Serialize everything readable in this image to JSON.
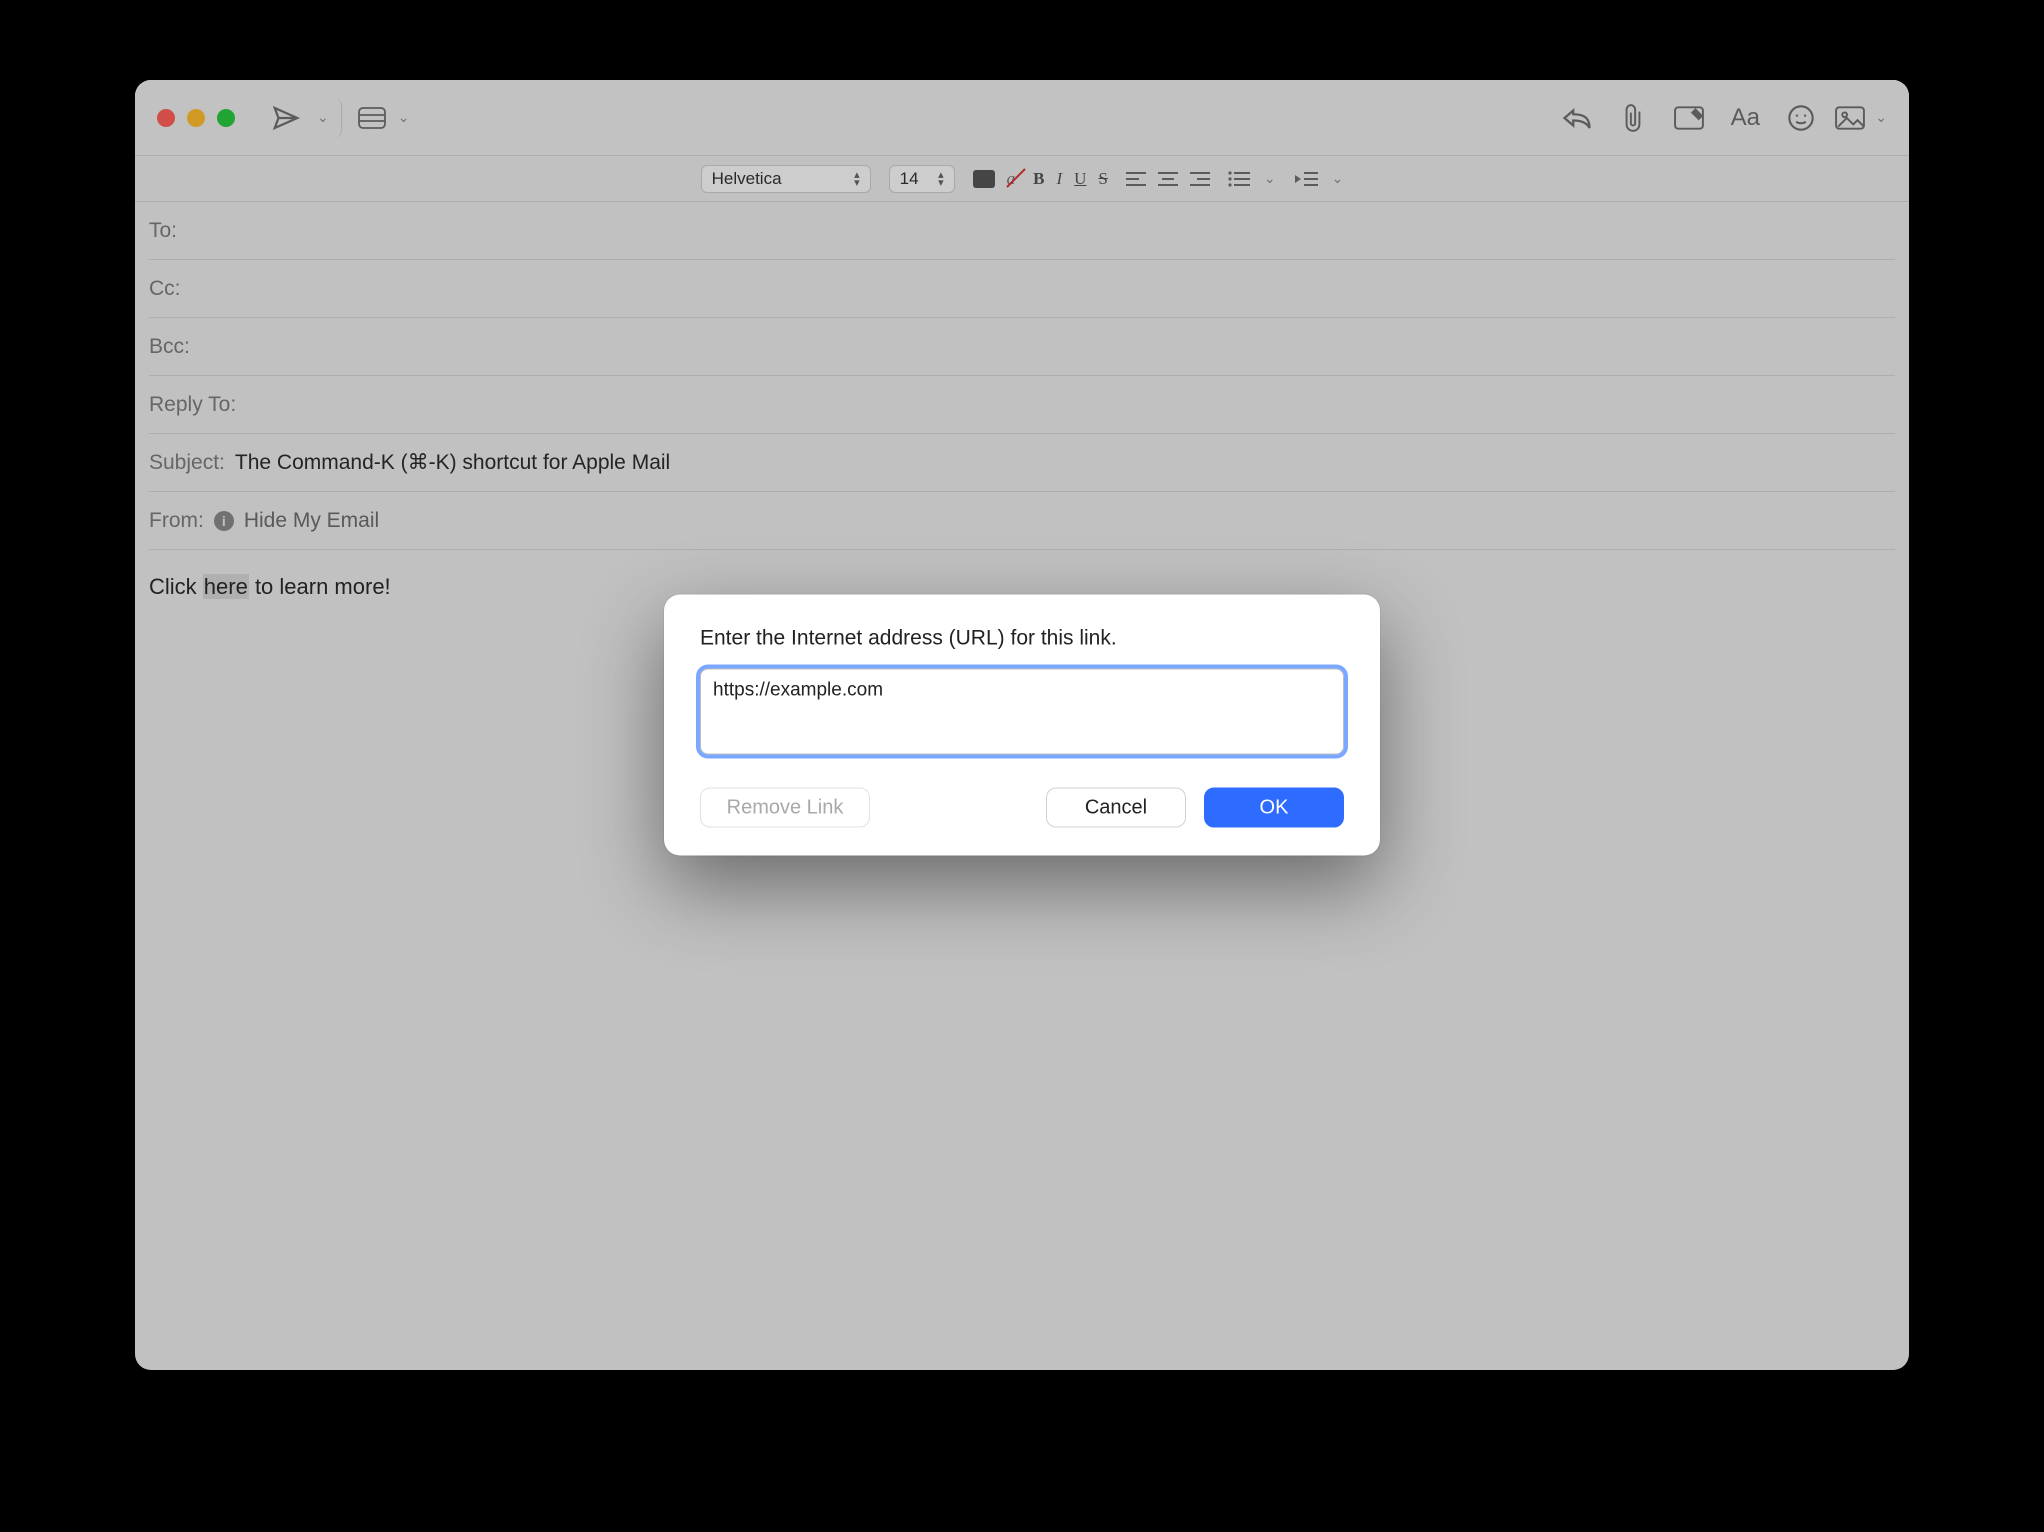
{
  "traffic": {
    "close": "close",
    "minimize": "minimize",
    "zoom": "zoom"
  },
  "formatbar": {
    "font": "Helvetica",
    "size": "14",
    "bold": "B",
    "italic": "I",
    "underline": "U",
    "strike": "S"
  },
  "headers": {
    "to_label": "To:",
    "cc_label": "Cc:",
    "bcc_label": "Bcc:",
    "replyto_label": "Reply To:",
    "subject_label": "Subject:",
    "subject_value": "The Command-K (⌘-K) shortcut for Apple Mail",
    "from_label": "From:",
    "from_value": "Hide My Email"
  },
  "body": {
    "pre": "Click ",
    "selected": "here",
    "post": " to learn more!"
  },
  "modal": {
    "prompt": "Enter the Internet address (URL) for this link.",
    "url": "https://example.com",
    "remove": "Remove Link",
    "cancel": "Cancel",
    "ok": "OK"
  }
}
